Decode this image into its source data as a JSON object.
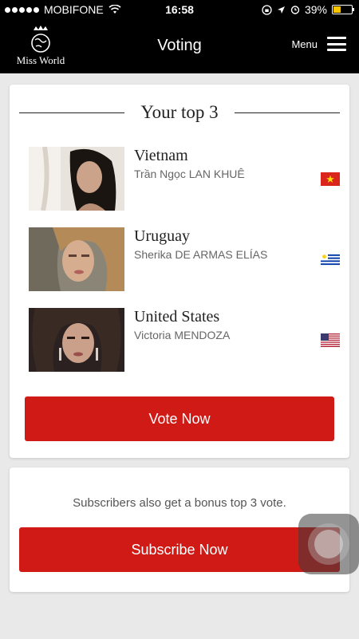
{
  "status_bar": {
    "carrier": "MOBIFONE",
    "time": "16:58",
    "battery": "39%",
    "battery_level": 0.39
  },
  "header": {
    "logo_text": "Miss World",
    "title": "Voting",
    "menu_label": "Menu"
  },
  "top3": {
    "heading": "Your top 3",
    "entries": [
      {
        "country": "Vietnam",
        "name": "Trần Ngọc LAN KHUÊ",
        "flag": "vietnam-flag-icon"
      },
      {
        "country": "Uruguay",
        "name": "Sherika DE ARMAS ELÍAS",
        "flag": "uruguay-flag-icon"
      },
      {
        "country": "United States",
        "name": "Victoria MENDOZA",
        "flag": "usa-flag-icon"
      }
    ],
    "vote_button": "Vote Now"
  },
  "subscribe": {
    "info": "Subscribers also get a bonus top 3 vote.",
    "button": "Subscribe Now"
  },
  "colors": {
    "accent": "#d01a16",
    "header_bg": "#000000",
    "page_bg": "#e9e9e9"
  }
}
